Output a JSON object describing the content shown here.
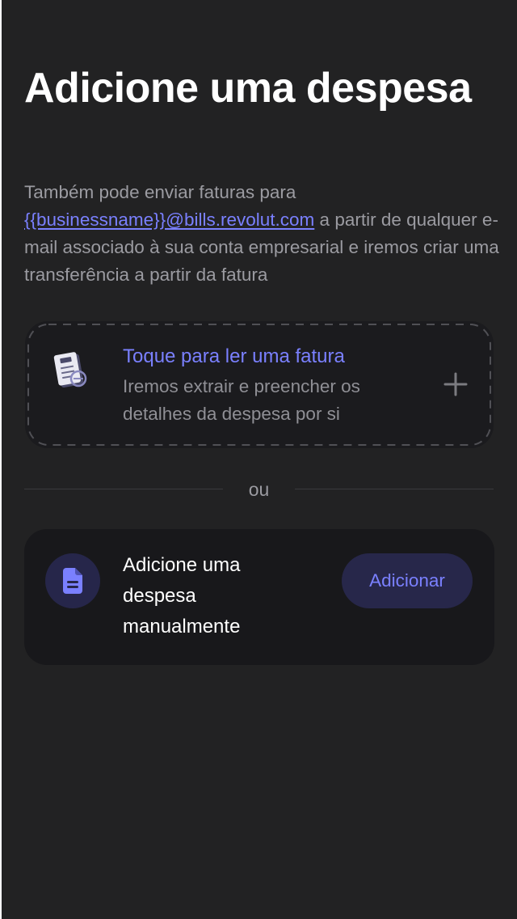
{
  "header": {
    "title": "Adicione uma despesa",
    "description": {
      "part1": "Também pode enviar faturas para ",
      "email_link": "{{businessname}}@bills.revolut.com",
      "part2": " a partir de qualquer e-mail associado à sua conta empresarial e iremos criar uma transferência a partir da fatura"
    }
  },
  "scan_card": {
    "title": "Toque para ler uma fatura",
    "subtitle": "Iremos extrair e preencher os detalhes da despesa por si",
    "icon": "invoice-scan-icon",
    "action_icon": "plus-icon"
  },
  "divider": {
    "label": "ou"
  },
  "manual_card": {
    "label": "Adicione uma despesa manualmente",
    "button_label": "Adicionar",
    "icon": "document-icon"
  },
  "colors": {
    "background": "#222223",
    "card_background": "#1b1b1e",
    "accent": "#7a80ff",
    "muted_text": "#9b9ba1",
    "button_background": "#27274a"
  }
}
